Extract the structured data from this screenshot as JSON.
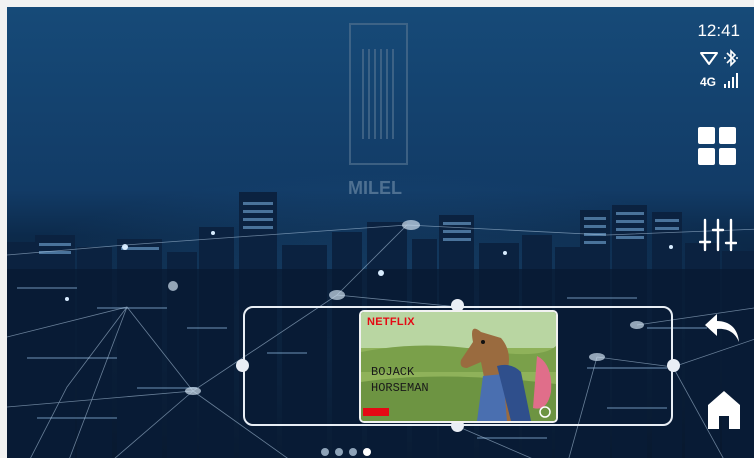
{
  "status": {
    "time": "12:41",
    "network": "4G",
    "icons": [
      "wifi-icon",
      "bluetooth-icon",
      "signal-icon"
    ]
  },
  "wallpaper": {
    "brand": "MILEL"
  },
  "dock": {
    "apps_icon": "grid-apps-icon",
    "settings_icon": "sliders-icon",
    "back_icon": "back-arrow-icon",
    "home_icon": "home-icon"
  },
  "widget": {
    "provider": "NETFLIX",
    "title": "BoJACK HORSEMAN",
    "badge_color": "#e50914"
  },
  "pager": {
    "pages": 4,
    "active_page": 4
  }
}
